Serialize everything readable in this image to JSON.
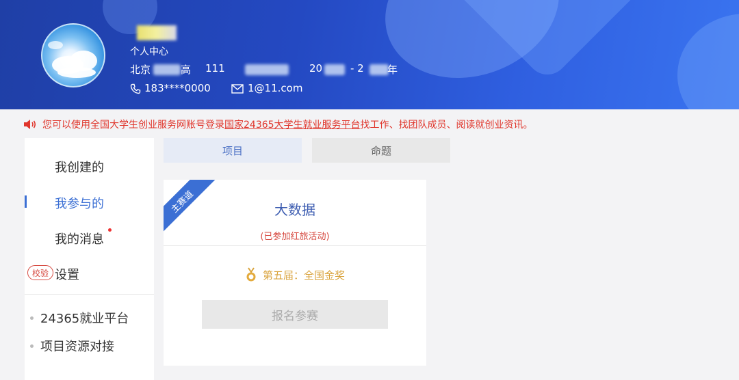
{
  "header": {
    "center_label": "个人中心",
    "school": "北京",
    "school_tail": "高",
    "number": "111",
    "years_prefix": "20",
    "years_dash": "- 2",
    "years_suffix": "年",
    "phone": "183****0000",
    "email": "1@11.com"
  },
  "notice": {
    "text_before": "您可以使用全国大学生创业服务网账号登录",
    "link_text": "国家24365大学生就业服务平台",
    "text_after": "找工作、找团队成员、阅读就创业资讯。"
  },
  "sidebar": {
    "items": [
      {
        "label": "我创建的"
      },
      {
        "label": "我参与的"
      },
      {
        "label": "我的消息"
      },
      {
        "label": "设置"
      }
    ],
    "badge": "校验",
    "links": [
      {
        "label": "24365就业平台"
      },
      {
        "label": "项目资源对接"
      }
    ]
  },
  "tabs": [
    {
      "label": "项目"
    },
    {
      "label": "命题"
    }
  ],
  "card": {
    "ribbon": "主赛道",
    "title": "大数据",
    "subtitle": "(已参加红旅活动)",
    "award": "第五届：全国金奖",
    "button": "报名参赛"
  },
  "colors": {
    "header_blue": "#2449c2",
    "accent_blue": "#3b6fd4",
    "notice_red": "#e0352b",
    "award_gold": "#d9a23a"
  },
  "icons": {
    "phone": "phone-icon",
    "email": "envelope-icon",
    "notice": "speaker-icon",
    "award": "medal-icon"
  }
}
